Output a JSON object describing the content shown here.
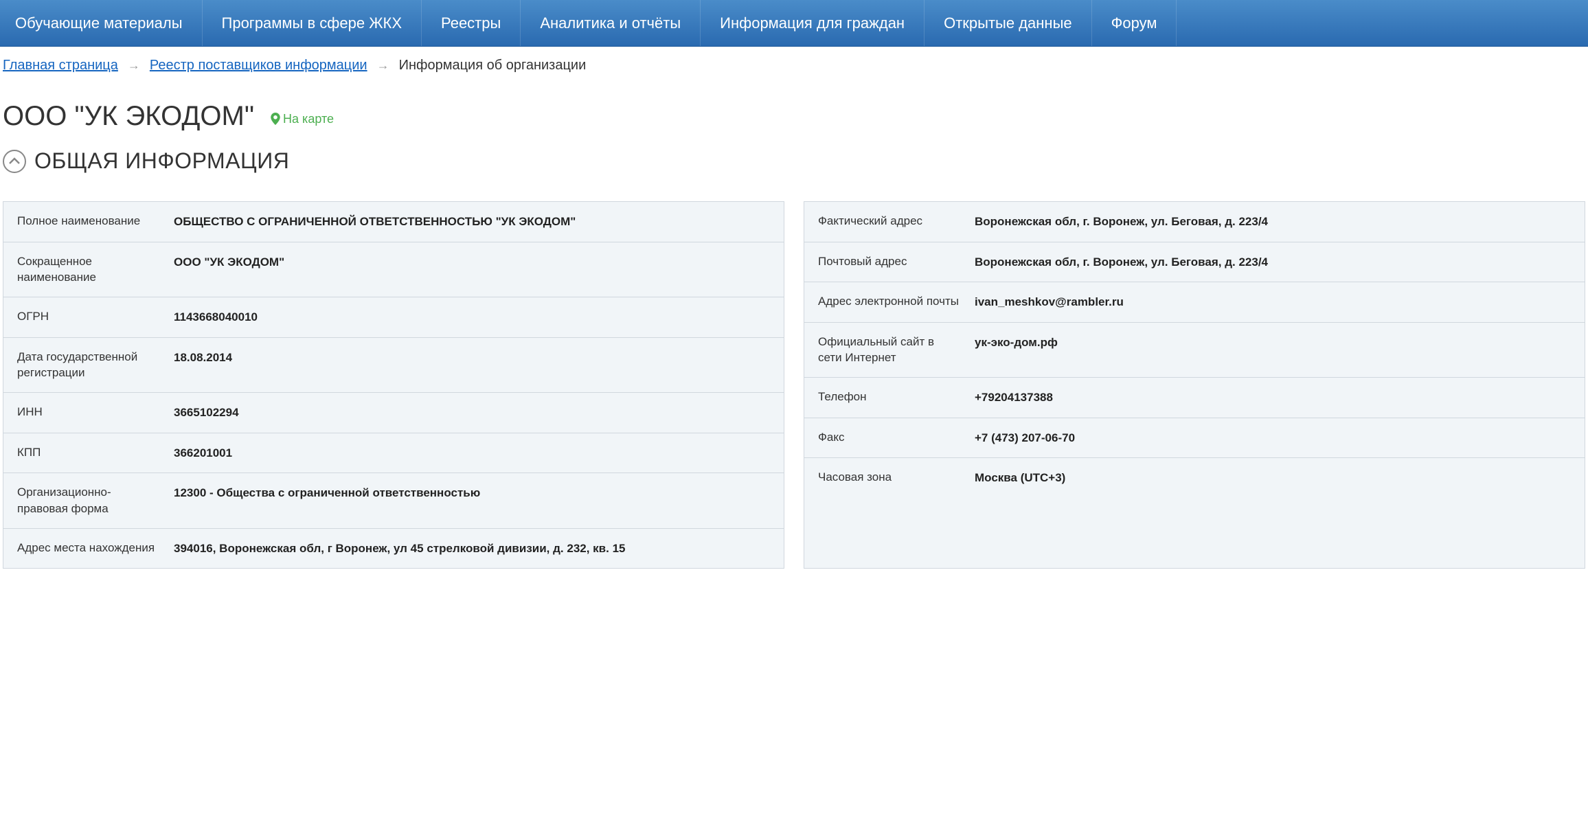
{
  "nav": {
    "items": [
      "Обучающие материалы",
      "Программы в сфере ЖКХ",
      "Реестры",
      "Аналитика и отчёты",
      "Информация для граждан",
      "Открытые данные",
      "Форум"
    ]
  },
  "breadcrumb": {
    "home": "Главная страница",
    "registry": "Реестр поставщиков информации",
    "current": "Информация об организации"
  },
  "title": "ООО \"УК ЭКОДОМ\"",
  "map_link": "На карте",
  "section_title": "ОБЩАЯ ИНФОРМАЦИЯ",
  "left_rows": [
    {
      "label": "Полное наименование",
      "value": "ОБЩЕСТВО С ОГРАНИЧЕННОЙ ОТВЕТСТВЕННОСТЬЮ \"УК ЭКОДОМ\""
    },
    {
      "label": "Сокращенное наименование",
      "value": "ООО \"УК ЭКОДОМ\""
    },
    {
      "label": "ОГРН",
      "value": "1143668040010"
    },
    {
      "label": "Дата государственной регистрации",
      "value": "18.08.2014"
    },
    {
      "label": "ИНН",
      "value": "3665102294"
    },
    {
      "label": "КПП",
      "value": "366201001"
    },
    {
      "label": "Организационно-правовая форма",
      "value": "12300 - Общества с ограниченной ответственностью"
    },
    {
      "label": "Адрес места нахождения",
      "value": "394016, Воронежская обл, г Воронеж, ул 45 стрелковой дивизии, д. 232, кв. 15"
    }
  ],
  "right_rows": [
    {
      "label": "Фактический адрес",
      "value": "Воронежская обл, г. Воронеж, ул. Беговая, д. 223/4"
    },
    {
      "label": "Почтовый адрес",
      "value": "Воронежская обл, г. Воронеж, ул. Беговая, д. 223/4"
    },
    {
      "label": "Адрес электронной почты",
      "value": "ivan_meshkov@rambler.ru"
    },
    {
      "label": "Официальный сайт в сети Интернет",
      "value": "ук-эко-дом.рф"
    },
    {
      "label": "Телефон",
      "value": "+79204137388"
    },
    {
      "label": "Факс",
      "value": "+7 (473) 207-06-70"
    },
    {
      "label": "Часовая зона",
      "value": "Москва (UTC+3)"
    }
  ]
}
